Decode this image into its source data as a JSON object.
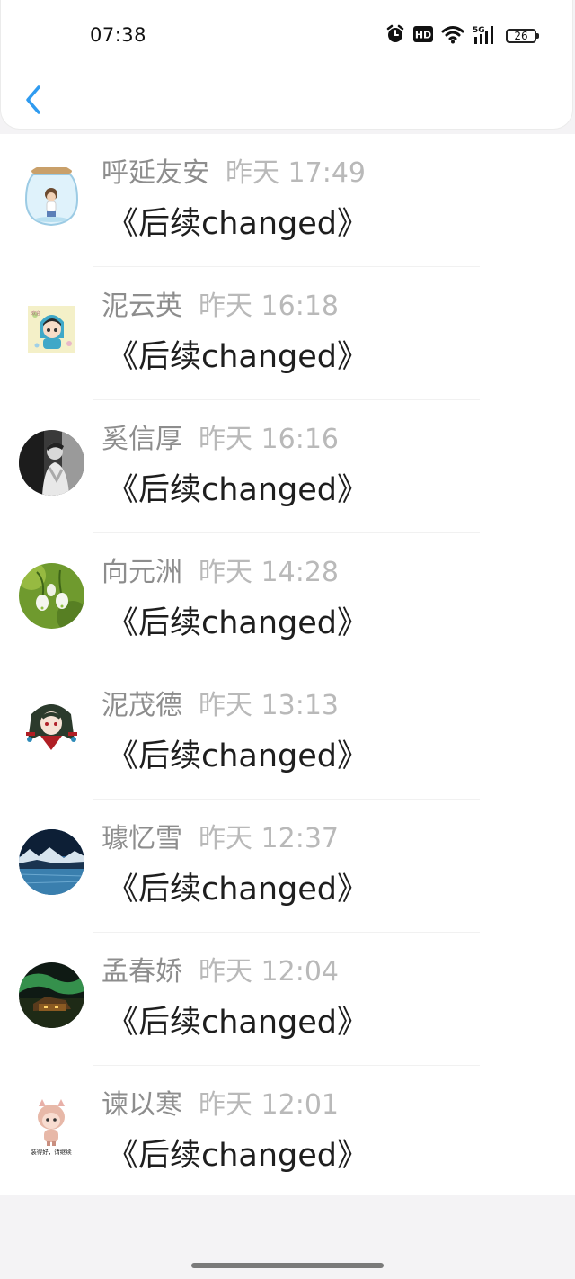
{
  "status_bar": {
    "time": "07:38",
    "icons": [
      "alarm-icon",
      "hd-icon",
      "wifi-icon",
      "signal-5g-icon"
    ],
    "battery": "26"
  },
  "header": {
    "back_icon": "chevron-left-icon",
    "accent": "#2f9bf0"
  },
  "comments": [
    {
      "name": "呼延友安",
      "time": "昨天 17:49",
      "content": "《后续changed》",
      "avatar": "glass-jar-avatar"
    },
    {
      "name": "泥云英",
      "time": "昨天 16:18",
      "content": "《后续changed》",
      "avatar": "anime-boy-avatar"
    },
    {
      "name": "奚信厚",
      "time": "昨天 16:16",
      "content": "《后续changed》",
      "avatar": "bw-portrait-avatar"
    },
    {
      "name": "向元洲",
      "time": "昨天 14:28",
      "content": "《后续changed》",
      "avatar": "snowdrop-flower-avatar"
    },
    {
      "name": "泥茂德",
      "time": "昨天 13:13",
      "content": "《后续changed》",
      "avatar": "anime-girl-avatar"
    },
    {
      "name": "璩忆雪",
      "time": "昨天 12:37",
      "content": "《后续changed》",
      "avatar": "lake-landscape-avatar"
    },
    {
      "name": "孟春娇",
      "time": "昨天 12:04",
      "content": "《后续changed》",
      "avatar": "aurora-night-avatar"
    },
    {
      "name": "谏以寒",
      "time": "昨天 12:01",
      "content": "《后续changed》",
      "avatar": "cartoon-doll-avatar",
      "avatar_caption": "装得好，请继续"
    }
  ]
}
